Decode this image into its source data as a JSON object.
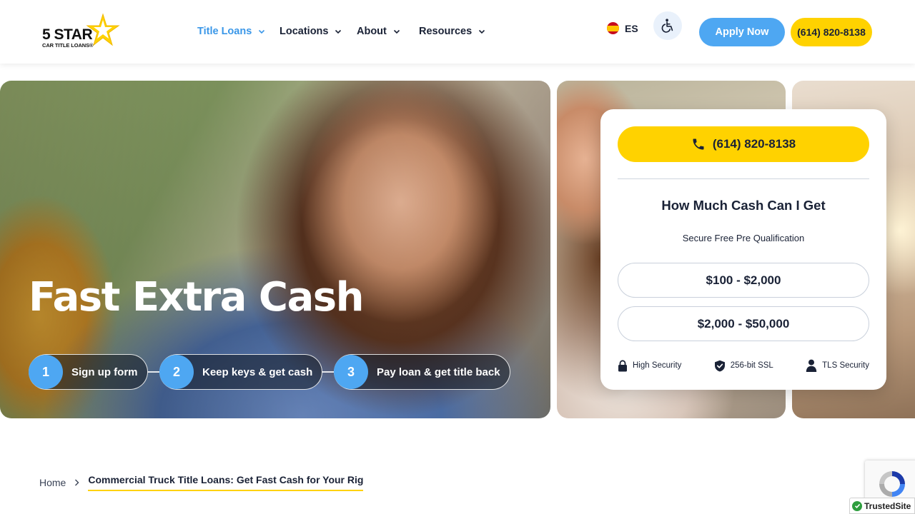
{
  "header": {
    "logo": {
      "main": "5 STAR",
      "sub": "CAR TITLE LOANS®"
    },
    "nav": [
      {
        "label": "Title Loans",
        "active": true
      },
      {
        "label": "Locations",
        "active": false
      },
      {
        "label": "About",
        "active": false
      },
      {
        "label": "Resources",
        "active": false
      }
    ],
    "language": "ES",
    "apply_label": "Apply Now",
    "phone_label": "(614) 820-8138"
  },
  "hero": {
    "title": "Fast Extra Cash",
    "steps": [
      {
        "num": "1",
        "label": "Sign up form"
      },
      {
        "num": "2",
        "label": "Keep keys & get cash"
      },
      {
        "num": "3",
        "label": "Pay loan & get title back"
      }
    ]
  },
  "card": {
    "phone": "(614) 820-8138",
    "title": "How Much Cash Can I Get",
    "subtitle": "Secure Free Pre Qualification",
    "amounts": [
      "$100 - $2,000",
      "$2,000 - $50,000"
    ],
    "security": [
      "High Security",
      "256-bit SSL",
      "TLS Security"
    ]
  },
  "breadcrumb": {
    "home": "Home",
    "current": "Commercial Truck Title Loans: Get Fast Cash for Your Rig"
  },
  "trusted_site": "TrustedSite",
  "colors": {
    "accent_blue": "#4ea7f2",
    "accent_yellow": "#ffd200",
    "text_dark": "#1a2236"
  }
}
